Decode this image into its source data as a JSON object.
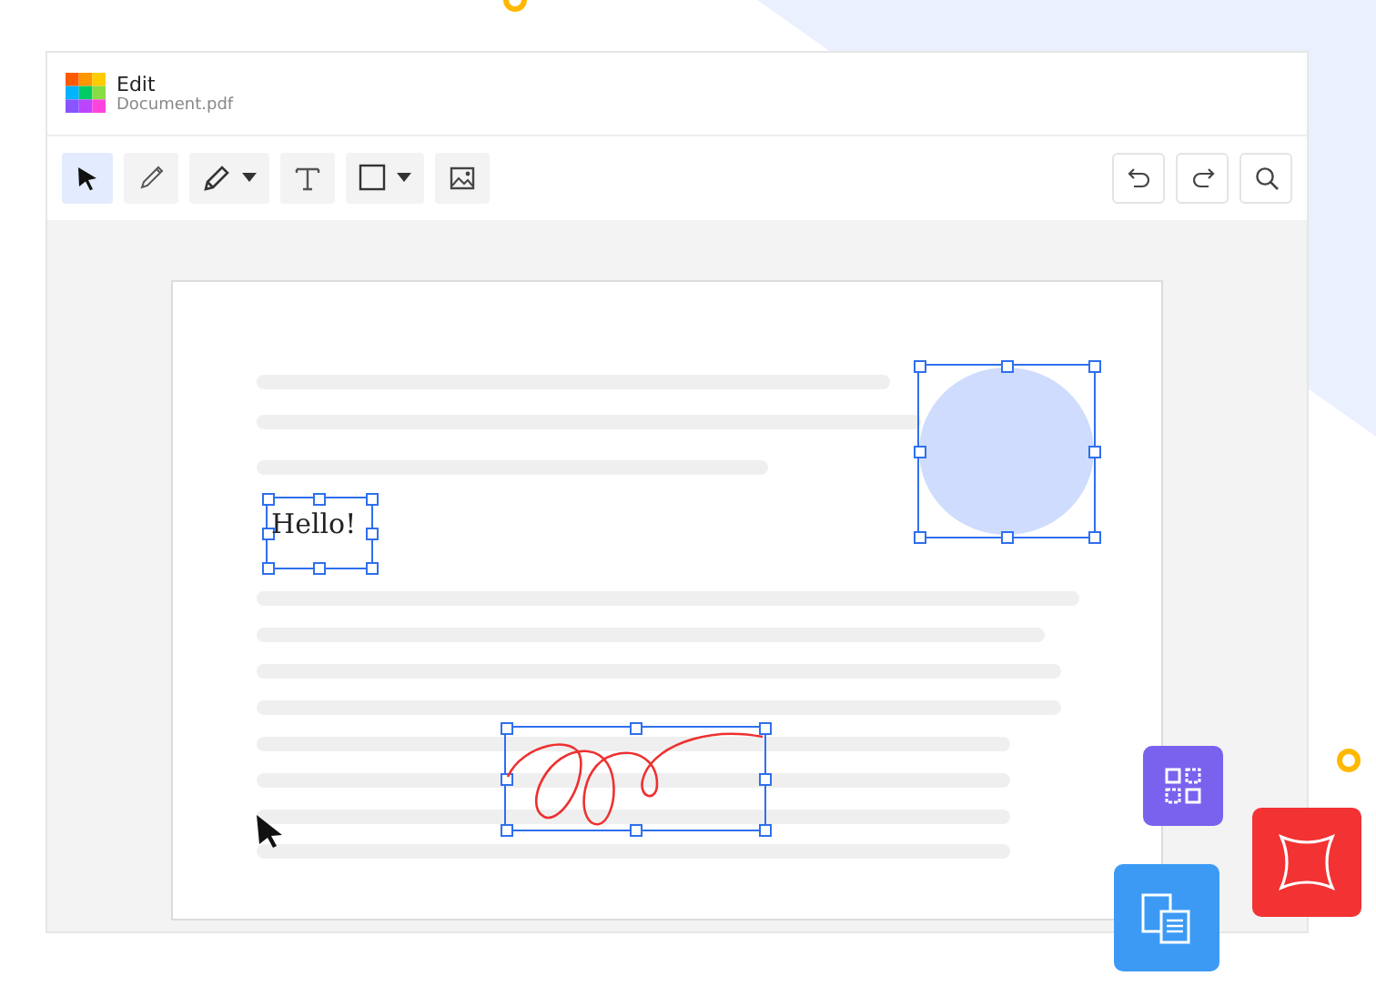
{
  "window": {
    "title": "Edit",
    "file_name": "Document.pdf"
  },
  "toolbar": {
    "tools": [
      {
        "kind": "select",
        "selected": true,
        "dropdown": false
      },
      {
        "kind": "pencil",
        "selected": false,
        "dropdown": false
      },
      {
        "kind": "highlighter",
        "selected": false,
        "dropdown": true
      },
      {
        "kind": "text",
        "selected": false,
        "dropdown": false
      },
      {
        "kind": "rectangle",
        "selected": false,
        "dropdown": true
      },
      {
        "kind": "image",
        "selected": false,
        "dropdown": false
      }
    ],
    "actions": [
      {
        "kind": "undo"
      },
      {
        "kind": "redo"
      },
      {
        "kind": "search"
      }
    ]
  },
  "page": {
    "text_box": {
      "text": "Hello!"
    }
  }
}
